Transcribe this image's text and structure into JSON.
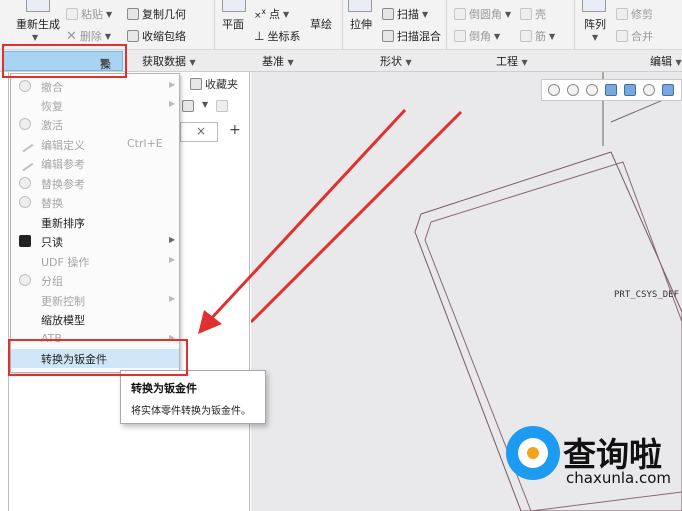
{
  "ribbon": {
    "regenerate": "重新生成",
    "paste": "粘贴",
    "delete": "删除",
    "copy_geometry": "复制几何",
    "shrinkwrap": "收缩包络",
    "plane": "平面",
    "point": "点",
    "axis_label": "x",
    "csys": "坐标系",
    "sketch": "草绘",
    "extrude": "拉伸",
    "sweep": "扫描",
    "swept_blend": "扫描混合",
    "round": "倒圆角",
    "chamfer": "倒角",
    "shell": "壳",
    "rib": "筋",
    "pattern": "阵列",
    "trim": "修剪",
    "merge": "合并",
    "groups": [
      "操作",
      "获取数据",
      "基准",
      "形状",
      "工程",
      "编辑"
    ]
  },
  "panel": {
    "favorites_tab": "收藏夹",
    "clear": "×",
    "add": "+"
  },
  "menu": {
    "items": [
      {
        "label": "撤合",
        "icon": "placeholder-icon",
        "disabled": true,
        "submenu": true
      },
      {
        "label": "恢复",
        "icon": "",
        "disabled": true,
        "submenu": true
      },
      {
        "label": "激活",
        "icon": "gear-icon",
        "disabled": true,
        "submenu": false
      },
      {
        "label": "编辑定义",
        "icon": "pencil-icon",
        "disabled": true,
        "submenu": false,
        "shortcut": "Ctrl+E"
      },
      {
        "label": "编辑参考",
        "icon": "pencil-icon",
        "disabled": true,
        "submenu": false
      },
      {
        "label": "替换参考",
        "icon": "link-icon",
        "disabled": true,
        "submenu": false
      },
      {
        "label": "替换",
        "icon": "gear-icon",
        "disabled": true,
        "submenu": false
      },
      {
        "label": "重新排序",
        "icon": "",
        "disabled": false,
        "submenu": false
      },
      {
        "label": "只读",
        "icon": "lock-icon",
        "disabled": false,
        "submenu": true
      },
      {
        "label": "UDF 操作",
        "icon": "",
        "disabled": true,
        "submenu": true
      },
      {
        "label": "分组",
        "icon": "group-icon",
        "disabled": true,
        "submenu": false
      },
      {
        "label": "更新控制",
        "icon": "",
        "disabled": true,
        "submenu": true
      },
      {
        "label": "缩放模型",
        "icon": "",
        "disabled": false,
        "submenu": false
      },
      {
        "label": "ATB",
        "icon": "",
        "disabled": true,
        "submenu": true
      },
      {
        "label": "转换为钣金件",
        "icon": "",
        "disabled": false,
        "submenu": false,
        "highlighted": true
      }
    ]
  },
  "tooltip": {
    "title": "转换为钣金件",
    "description": "将实体零件转换为钣金件。"
  },
  "graphics": {
    "csys_label": "PRT_CSYS_DEF"
  },
  "watermark": {
    "brand": "查询啦",
    "domain": "chaxunla.com"
  },
  "colors": {
    "highlight_red": "#e03030",
    "operations_group_bg": "#a9d3f3",
    "menu_hover": "#cfe6f8",
    "arrow_red": "#e03030",
    "watermark_blue": "#1d9bf0"
  }
}
